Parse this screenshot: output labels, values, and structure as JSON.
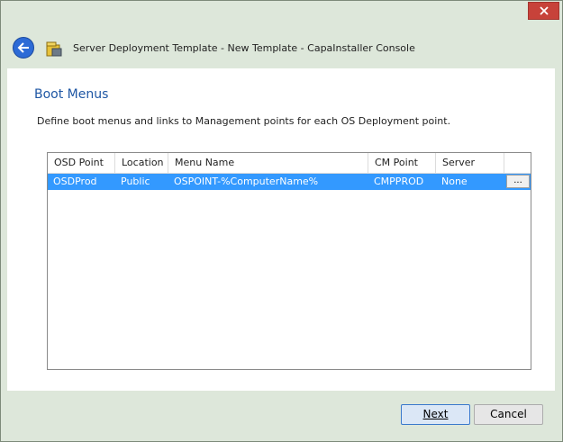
{
  "window": {
    "title": "Server Deployment Template - New Template - CapaInstaller Console",
    "close_icon": "close-icon"
  },
  "page": {
    "heading": "Boot Menus",
    "description": "Define boot menus and links to Management points for each OS Deployment point."
  },
  "grid": {
    "columns": [
      "OSD Point",
      "Location",
      "Menu Name",
      "CM Point",
      "Server"
    ],
    "rows": [
      {
        "osd_point": "OSDProd",
        "location": "Public",
        "menu_name": "OSPOINT-%ComputerName%",
        "cm_point": "CMPPROD",
        "server": "None",
        "action": "..."
      }
    ],
    "selected_row_color": "#3399ff"
  },
  "footer": {
    "next_label": "Next",
    "cancel_label": "Cancel"
  }
}
